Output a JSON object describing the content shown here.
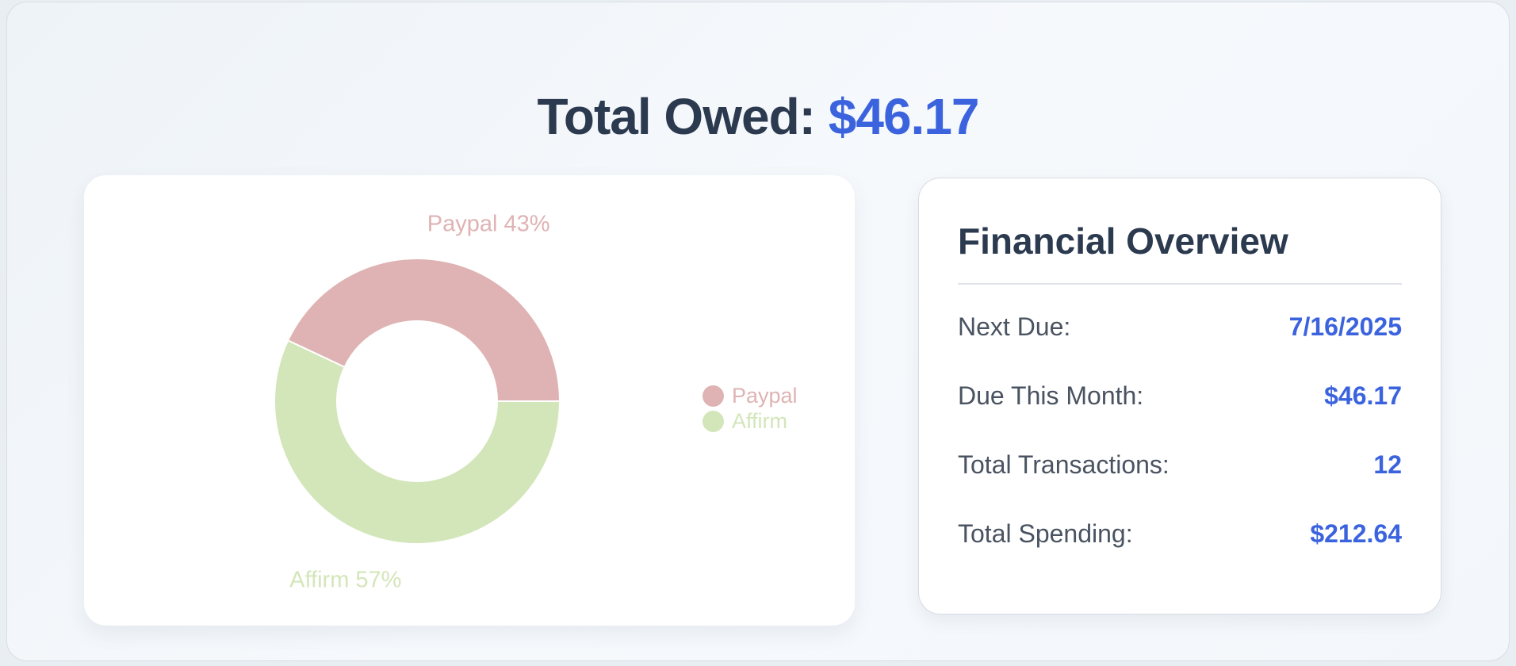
{
  "header": {
    "label": "Total Owed:",
    "amount": "$46.17"
  },
  "chart_data": {
    "type": "pie",
    "donut": true,
    "categories": [
      "Paypal",
      "Affirm"
    ],
    "values": [
      43,
      57
    ],
    "unit": "%",
    "slice_labels": [
      "Paypal 43%",
      "Affirm 57%"
    ],
    "colors": [
      "#dfb3b3",
      "#d3e6ba"
    ],
    "legend": {
      "placement": "right",
      "entries": [
        "Paypal",
        "Affirm"
      ]
    }
  },
  "overview": {
    "title": "Financial Overview",
    "rows": [
      {
        "label": "Next Due:",
        "value": "7/16/2025"
      },
      {
        "label": "Due This Month:",
        "value": "$46.17"
      },
      {
        "label": "Total Transactions:",
        "value": "12"
      },
      {
        "label": "Total Spending:",
        "value": "$212.64"
      }
    ]
  },
  "colors": {
    "accent": "#3b63de",
    "heading": "#2c3a4f",
    "text": "#4a5361"
  }
}
